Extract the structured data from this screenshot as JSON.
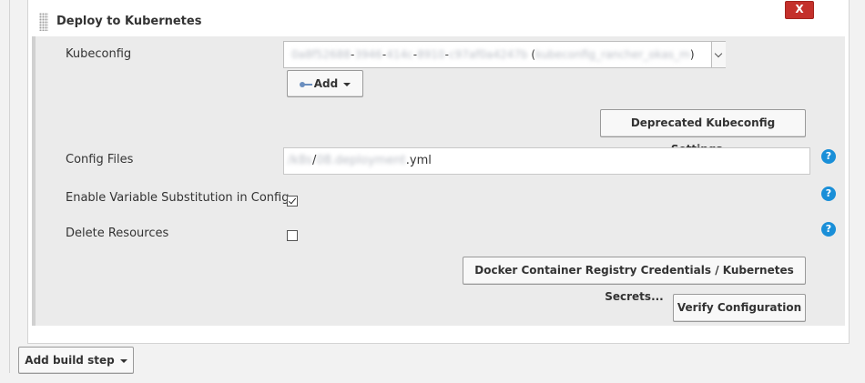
{
  "step": {
    "title": "Deploy to Kubernetes",
    "close_label": "X"
  },
  "kubeconfig": {
    "label": "Kubeconfig",
    "selected_value_blurred_id_part1": "0a8f52688",
    "selected_value_sep1": "-",
    "selected_value_blurred_id_part2": "3946",
    "selected_value_sep2": "-",
    "selected_value_blurred_id_part3": "414c",
    "selected_value_sep3": "-",
    "selected_value_blurred_id_part4": "8910",
    "selected_value_sep4": "-",
    "selected_value_blurred_id_part5": "c97af0a4247b",
    "selected_value_paren_open": " (",
    "selected_value_blurred_name": "kubeconfig_rancher_okas_m",
    "selected_value_paren_close": ")",
    "add_label": "Add",
    "deprecated_button": "Deprecated Kubeconfig Settings..."
  },
  "config_files": {
    "label": "Config Files",
    "value_blurred_dir": "/k8s",
    "value_sep": "/",
    "value_blurred_name": "08.deployment",
    "value_ext": ".yml"
  },
  "variable_substitution": {
    "label": "Enable Variable Substitution in Config",
    "checked": true
  },
  "delete_resources": {
    "label": "Delete Resources",
    "checked": false
  },
  "help_label": "?",
  "buttons": {
    "docker_registry": "Docker Container Registry Credentials / Kubernetes Secrets...",
    "verify": "Verify Configuration",
    "add_build_step": "Add build step"
  }
}
